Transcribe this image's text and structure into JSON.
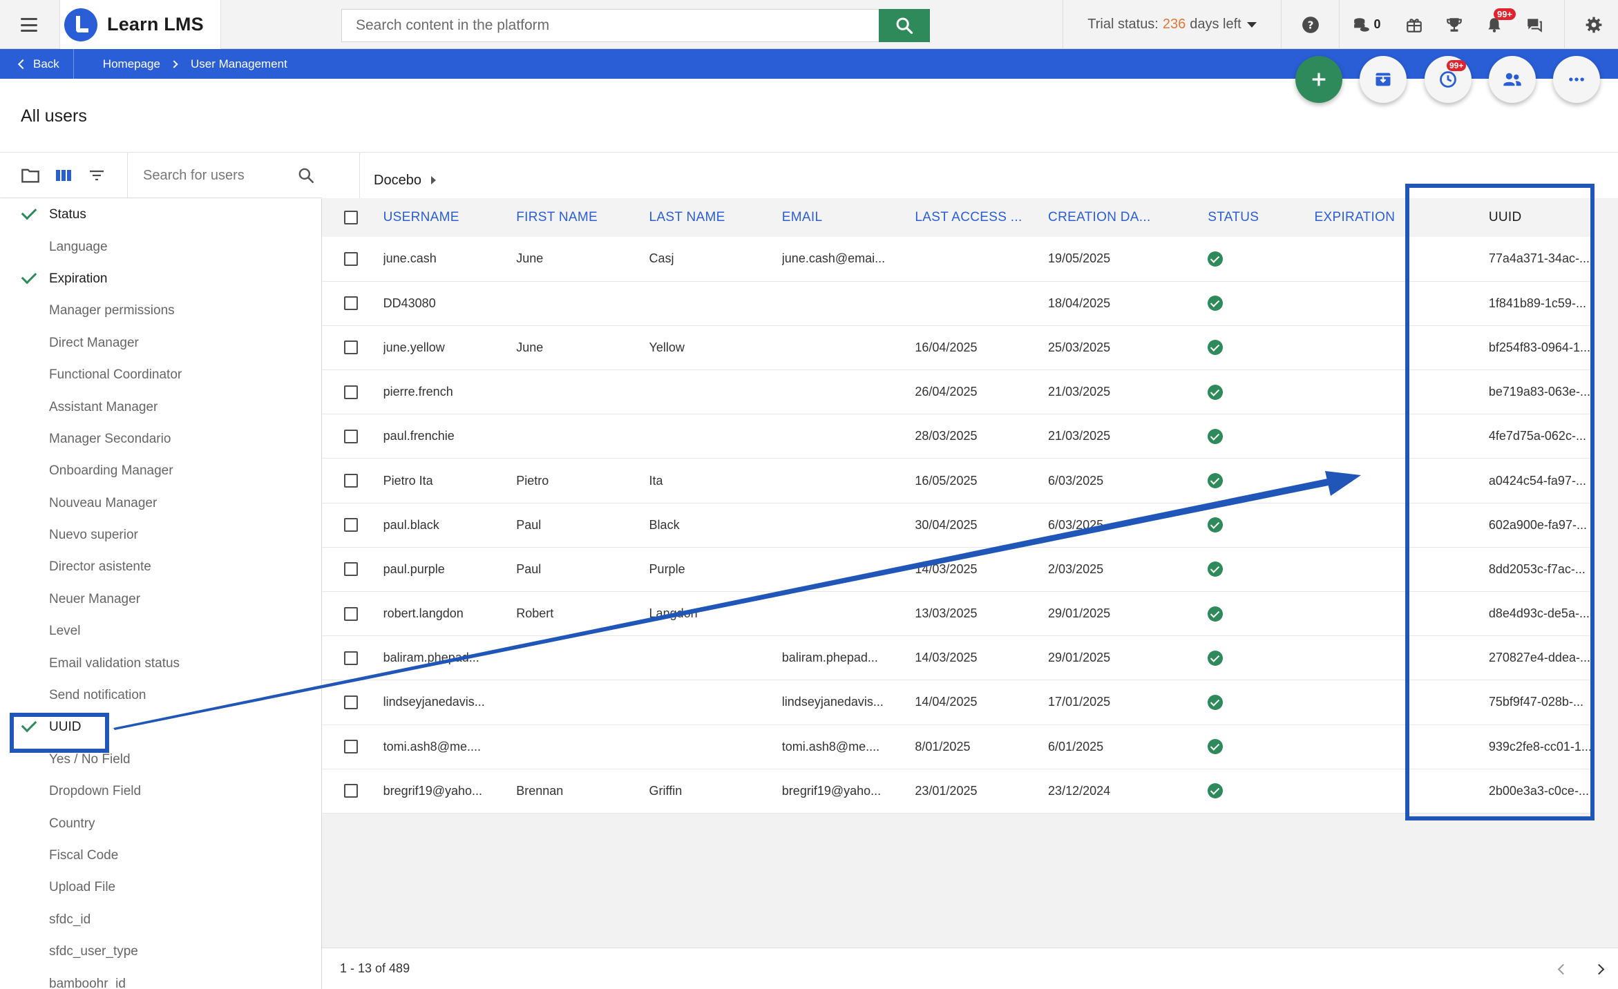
{
  "header": {
    "brand_name": "Learn LMS",
    "search_placeholder": "Search content in the platform",
    "trial_prefix": "Trial status:",
    "trial_days": "236",
    "trial_suffix": "days left",
    "coins_count": "0",
    "notifications_badge": "99+"
  },
  "breadcrumb": {
    "back_label": "Back",
    "items": [
      "Homepage",
      "User Management"
    ]
  },
  "actions": {
    "clock_badge": "99+"
  },
  "page": {
    "title": "All users"
  },
  "left_panel": {
    "search_placeholder": "Search for users",
    "columns": [
      {
        "label": "Status",
        "checked": true
      },
      {
        "label": "Language",
        "checked": false
      },
      {
        "label": "Expiration",
        "checked": true
      },
      {
        "label": "Manager permissions",
        "checked": false
      },
      {
        "label": "Direct Manager",
        "checked": false
      },
      {
        "label": "Functional Coordinator",
        "checked": false
      },
      {
        "label": "Assistant Manager",
        "checked": false
      },
      {
        "label": "Manager Secondario",
        "checked": false
      },
      {
        "label": "Onboarding Manager",
        "checked": false
      },
      {
        "label": "Nouveau Manager",
        "checked": false
      },
      {
        "label": "Nuevo superior",
        "checked": false
      },
      {
        "label": "Director asistente",
        "checked": false
      },
      {
        "label": "Neuer Manager",
        "checked": false
      },
      {
        "label": "Level",
        "checked": false
      },
      {
        "label": "Email validation status",
        "checked": false
      },
      {
        "label": "Send notification",
        "checked": false
      },
      {
        "label": "UUID",
        "checked": true
      },
      {
        "label": "Yes / No Field",
        "checked": false
      },
      {
        "label": "Dropdown Field",
        "checked": false
      },
      {
        "label": "Country",
        "checked": false
      },
      {
        "label": "Fiscal Code",
        "checked": false
      },
      {
        "label": "Upload File",
        "checked": false
      },
      {
        "label": "sfdc_id",
        "checked": false
      },
      {
        "label": "sfdc_user_type",
        "checked": false
      },
      {
        "label": "bamboohr_id",
        "checked": false
      }
    ]
  },
  "folder": {
    "name": "Docebo"
  },
  "table": {
    "headers": [
      "USERNAME",
      "FIRST NAME",
      "LAST NAME",
      "EMAIL",
      "LAST ACCESS ...",
      "CREATION DA...",
      "STATUS",
      "EXPIRATION",
      "UUID"
    ],
    "rows": [
      {
        "username": "june.cash",
        "first": "June",
        "last": "Casj",
        "email": "june.cash@emai...",
        "last_access": "",
        "created": "19/05/2025",
        "expiration": "",
        "uuid": "77a4a371-34ac-..."
      },
      {
        "username": "DD43080",
        "first": "",
        "last": "",
        "email": "",
        "last_access": "",
        "created": "18/04/2025",
        "expiration": "",
        "uuid": "1f841b89-1c59-..."
      },
      {
        "username": "june.yellow",
        "first": "June",
        "last": "Yellow",
        "email": "",
        "last_access": "16/04/2025",
        "created": "25/03/2025",
        "expiration": "",
        "uuid": "bf254f83-0964-1..."
      },
      {
        "username": "pierre.french",
        "first": "",
        "last": "",
        "email": "",
        "last_access": "26/04/2025",
        "created": "21/03/2025",
        "expiration": "",
        "uuid": "be719a83-063e-..."
      },
      {
        "username": "paul.frenchie",
        "first": "",
        "last": "",
        "email": "",
        "last_access": "28/03/2025",
        "created": "21/03/2025",
        "expiration": "",
        "uuid": "4fe7d75a-062c-..."
      },
      {
        "username": "Pietro Ita",
        "first": "Pietro",
        "last": "Ita",
        "email": "",
        "last_access": "16/05/2025",
        "created": "6/03/2025",
        "expiration": "",
        "uuid": "a0424c54-fa97-..."
      },
      {
        "username": "paul.black",
        "first": "Paul",
        "last": "Black",
        "email": "",
        "last_access": "30/04/2025",
        "created": "6/03/2025",
        "expiration": "",
        "uuid": "602a900e-fa97-..."
      },
      {
        "username": "paul.purple",
        "first": "Paul",
        "last": "Purple",
        "email": "",
        "last_access": "14/03/2025",
        "created": "2/03/2025",
        "expiration": "",
        "uuid": "8dd2053c-f7ac-..."
      },
      {
        "username": "robert.langdon",
        "first": "Robert",
        "last": "Langdon",
        "email": "",
        "last_access": "13/03/2025",
        "created": "29/01/2025",
        "expiration": "",
        "uuid": "d8e4d93c-de5a-..."
      },
      {
        "username": "baliram.phepad...",
        "first": "",
        "last": "",
        "email": "baliram.phepad...",
        "last_access": "14/03/2025",
        "created": "29/01/2025",
        "expiration": "",
        "uuid": "270827e4-ddea-..."
      },
      {
        "username": "lindseyjanedavis...",
        "first": "",
        "last": "",
        "email": "lindseyjanedavis...",
        "last_access": "14/04/2025",
        "created": "17/01/2025",
        "expiration": "",
        "uuid": "75bf9f47-028b-..."
      },
      {
        "username": "tomi.ash8@me....",
        "first": "",
        "last": "",
        "email": "tomi.ash8@me....",
        "last_access": "8/01/2025",
        "created": "6/01/2025",
        "expiration": "",
        "uuid": "939c2fe8-cc01-1..."
      },
      {
        "username": "bregrif19@yaho...",
        "first": "Brennan",
        "last": "Griffin",
        "email": "bregrif19@yaho...",
        "last_access": "23/01/2025",
        "created": "23/12/2024",
        "expiration": "",
        "uuid": "2b00e3a3-c0ce-..."
      }
    ]
  },
  "footer": {
    "range": "1 - 13 of 489"
  },
  "colors": {
    "brand_blue": "#2a5ed6",
    "annotation_blue": "#1f56b8",
    "success_green": "#2e8a5a",
    "trial_orange": "#e0763a",
    "badge_red": "#e0242d"
  }
}
